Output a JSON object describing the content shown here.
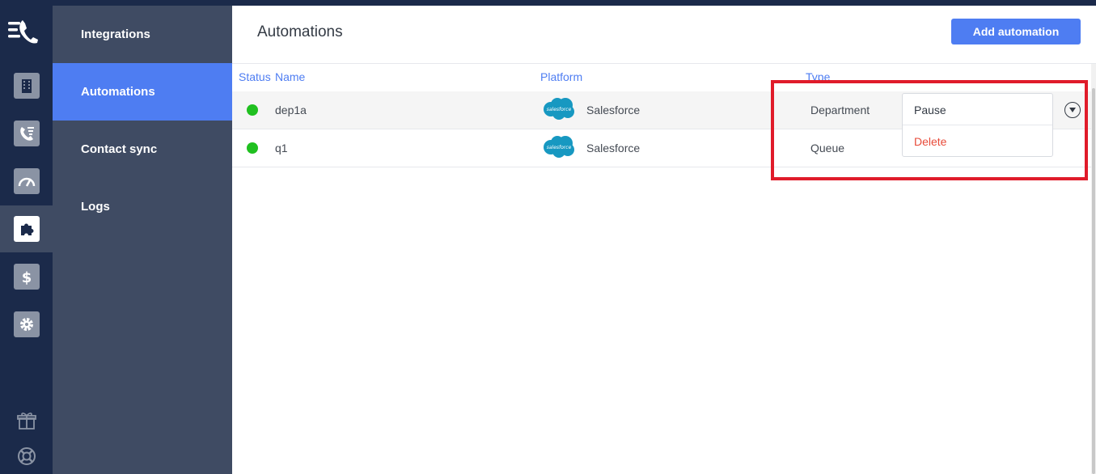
{
  "nav": {
    "items": [
      {
        "label": "Integrations"
      },
      {
        "label": "Automations"
      },
      {
        "label": "Contact sync"
      },
      {
        "label": "Logs"
      }
    ],
    "active": "Automations"
  },
  "main": {
    "title": "Automations",
    "add_button": "Add automation"
  },
  "table": {
    "columns": [
      "Status",
      "Name",
      "Platform",
      "Type"
    ],
    "rows": [
      {
        "status": "active",
        "name": "dep1a",
        "platform": "Salesforce",
        "type": "Department"
      },
      {
        "status": "active",
        "name": "q1",
        "platform": "Salesforce",
        "type": "Queue"
      }
    ]
  },
  "dropdown": {
    "items": [
      "Pause",
      "Delete"
    ]
  },
  "colors": {
    "accent": "#4e7df2",
    "sidebar": "#3f4b63",
    "rail": "#1b2a4a",
    "status_active": "#20c020",
    "danger": "#e84b3a",
    "highlight": "#e01b2a"
  },
  "icons": {
    "rail": [
      "logo-icon",
      "building-icon",
      "call-list-icon",
      "speedometer-icon",
      "puzzle-icon",
      "dollar-icon",
      "gear-icon",
      "gift-icon",
      "lifebuoy-icon"
    ],
    "platform": "salesforce-logo",
    "row_action": "chevron-down-icon"
  }
}
